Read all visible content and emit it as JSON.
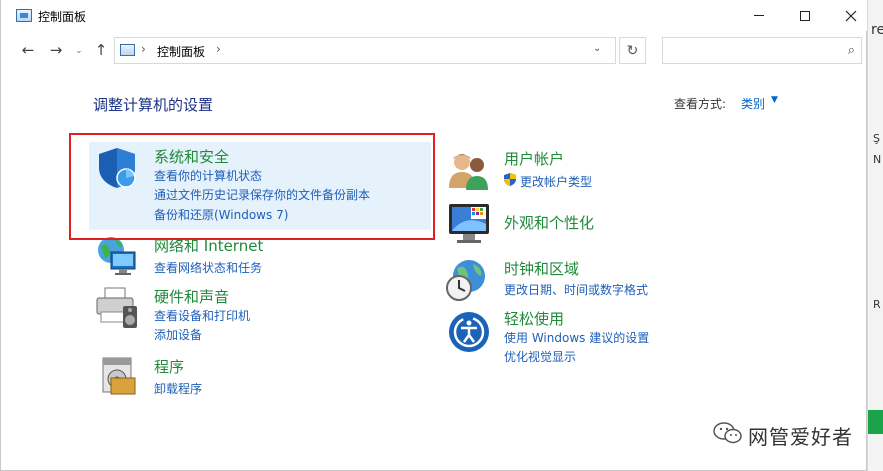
{
  "window": {
    "title": "控制面板"
  },
  "navigation": {
    "back": "←",
    "forward": "→",
    "recent": "⌄",
    "up": "↑",
    "address_separator": "›",
    "address_path": "控制面板",
    "dropdown": "⌄",
    "refresh": "↻",
    "search_placeholder": "",
    "search_icon": "⌕"
  },
  "header": {
    "page_title": "调整计算机的设置",
    "view_by_label": "查看方式:",
    "view_by_value": "类别"
  },
  "categories": [
    {
      "icon": "shield-icon",
      "title": "系统和安全",
      "links": [
        "查看你的计算机状态",
        "通过文件历史记录保存你的文件备份副本",
        "备份和还原(Windows 7)"
      ]
    },
    {
      "icon": "network-icon",
      "title": "网络和 Internet",
      "links": [
        "查看网络状态和任务"
      ]
    },
    {
      "icon": "printer-icon",
      "title": "硬件和声音",
      "links": [
        "查看设备和打印机",
        "添加设备"
      ]
    },
    {
      "icon": "programs-icon",
      "title": "程序",
      "links": [
        "卸载程序"
      ]
    },
    {
      "icon": "users-icon",
      "title": "用户帐户",
      "links": [
        "更改帐户类型"
      ]
    },
    {
      "icon": "display-icon",
      "title": "外观和个性化",
      "links": []
    },
    {
      "icon": "clock-globe-icon",
      "title": "时钟和区域",
      "links": [
        "更改日期、时间或数字格式"
      ]
    },
    {
      "icon": "ease-of-access-icon",
      "title": "轻松使用",
      "links": [
        "使用 Windows 建议的设置",
        "优化视觉显示"
      ]
    }
  ],
  "watermark": {
    "text": "网管爱好者"
  },
  "background_window": {
    "fragments": [
      "re",
      "Ş",
      "N",
      "R"
    ]
  },
  "colors": {
    "category_title": "#1f8a3a",
    "link": "#1e5fb8",
    "page_title": "#1e3287",
    "highlight": "#e5f1fb",
    "annotation_box": "#e02020"
  }
}
